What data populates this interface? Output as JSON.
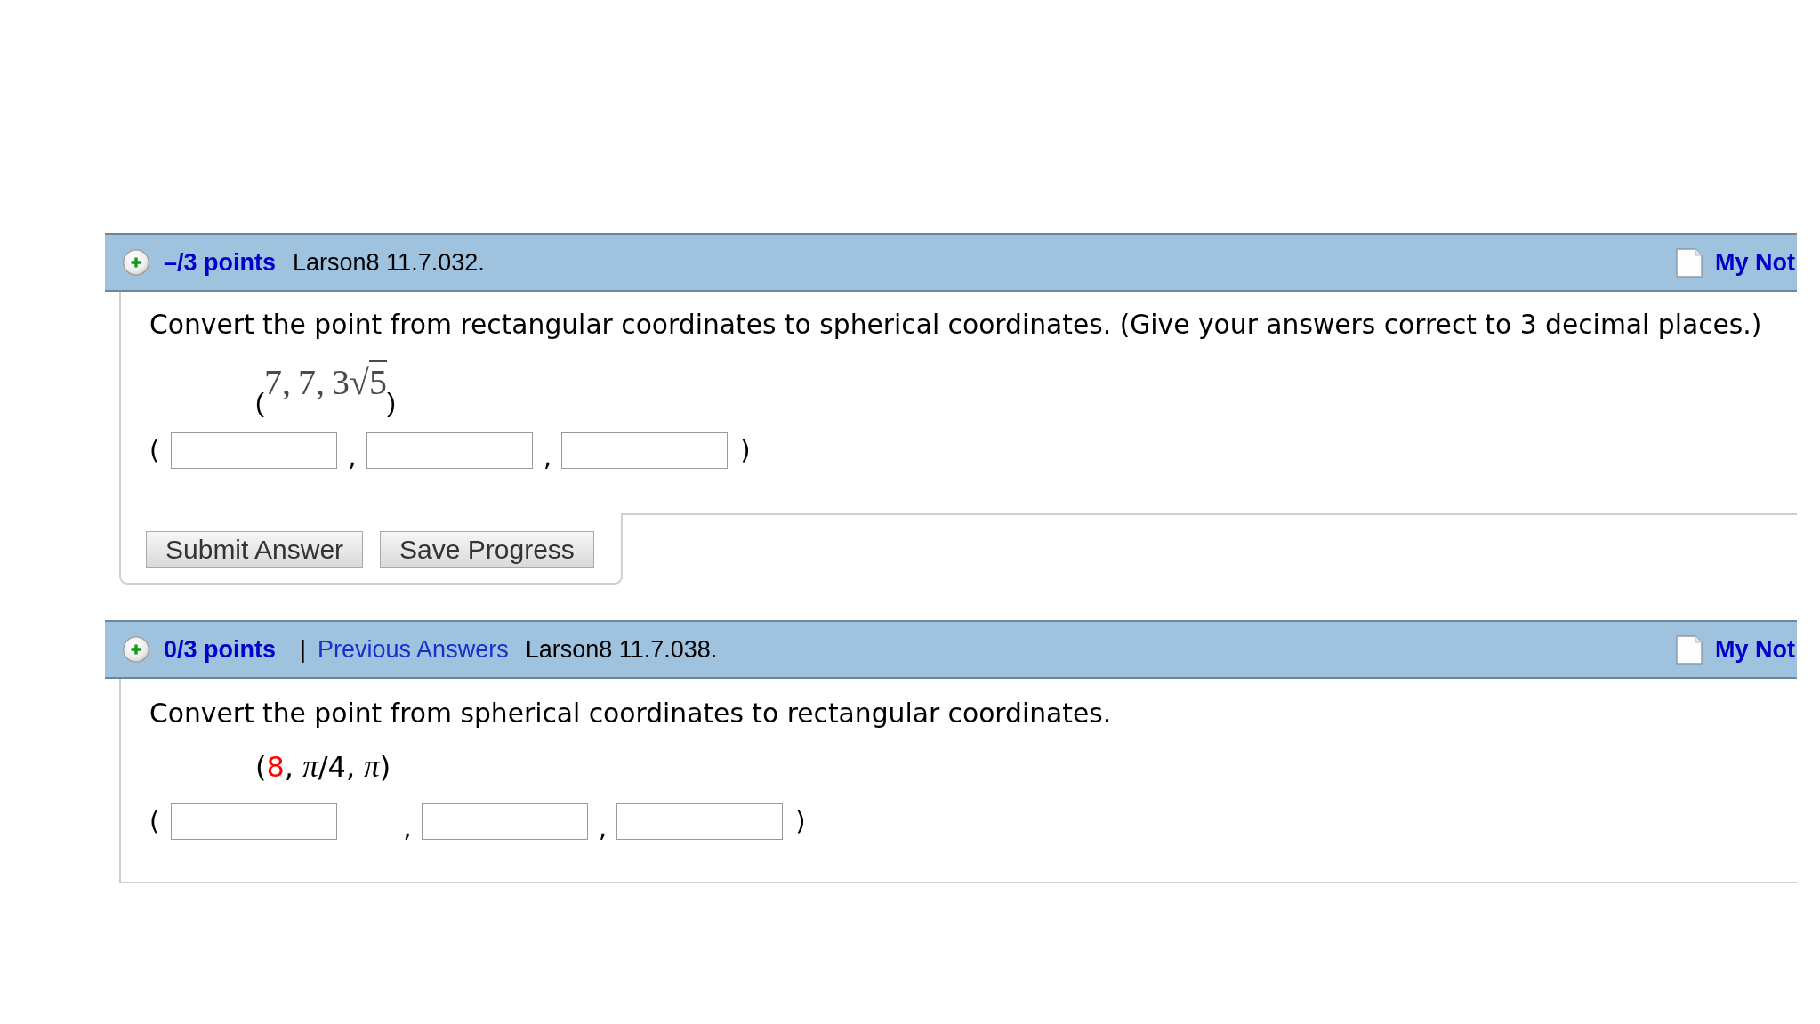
{
  "questions": [
    {
      "header": {
        "points": "–/3 points",
        "reference": "Larson8 11.7.032.",
        "notes": "My Not"
      },
      "prompt": "Convert the point from rectangular coordinates to spherical coordinates. (Give your answers correct to 3 decimal places.)",
      "point": [
        {
          "kind": "paren",
          "text": "("
        },
        {
          "kind": "math",
          "text": "7, 7, 3"
        },
        {
          "kind": "radical",
          "text": "√"
        },
        {
          "kind": "radicand",
          "text": "5"
        },
        {
          "kind": "paren",
          "text": ")"
        }
      ],
      "answer": {
        "open": "(",
        "separators": [
          ",",
          ","
        ],
        "close": ")"
      },
      "buttons": [
        "Submit Answer",
        "Save Progress"
      ]
    },
    {
      "header": {
        "points": "0/3 points",
        "separator": "|",
        "previous_answers": "Previous Answers",
        "reference": "Larson8 11.7.038.",
        "notes": "My Not"
      },
      "prompt": "Convert the point from spherical coordinates to rectangular coordinates.",
      "point": [
        {
          "kind": "text",
          "text": "("
        },
        {
          "kind": "variable",
          "text": "8"
        },
        {
          "kind": "text",
          "text": ", "
        },
        {
          "kind": "symbol",
          "text": "π"
        },
        {
          "kind": "text",
          "text": "/4, "
        },
        {
          "kind": "symbol",
          "text": "π"
        },
        {
          "kind": "text",
          "text": ")"
        }
      ],
      "answer": {
        "open": "(",
        "separators": [
          ",",
          ","
        ],
        "close": ")"
      }
    }
  ]
}
